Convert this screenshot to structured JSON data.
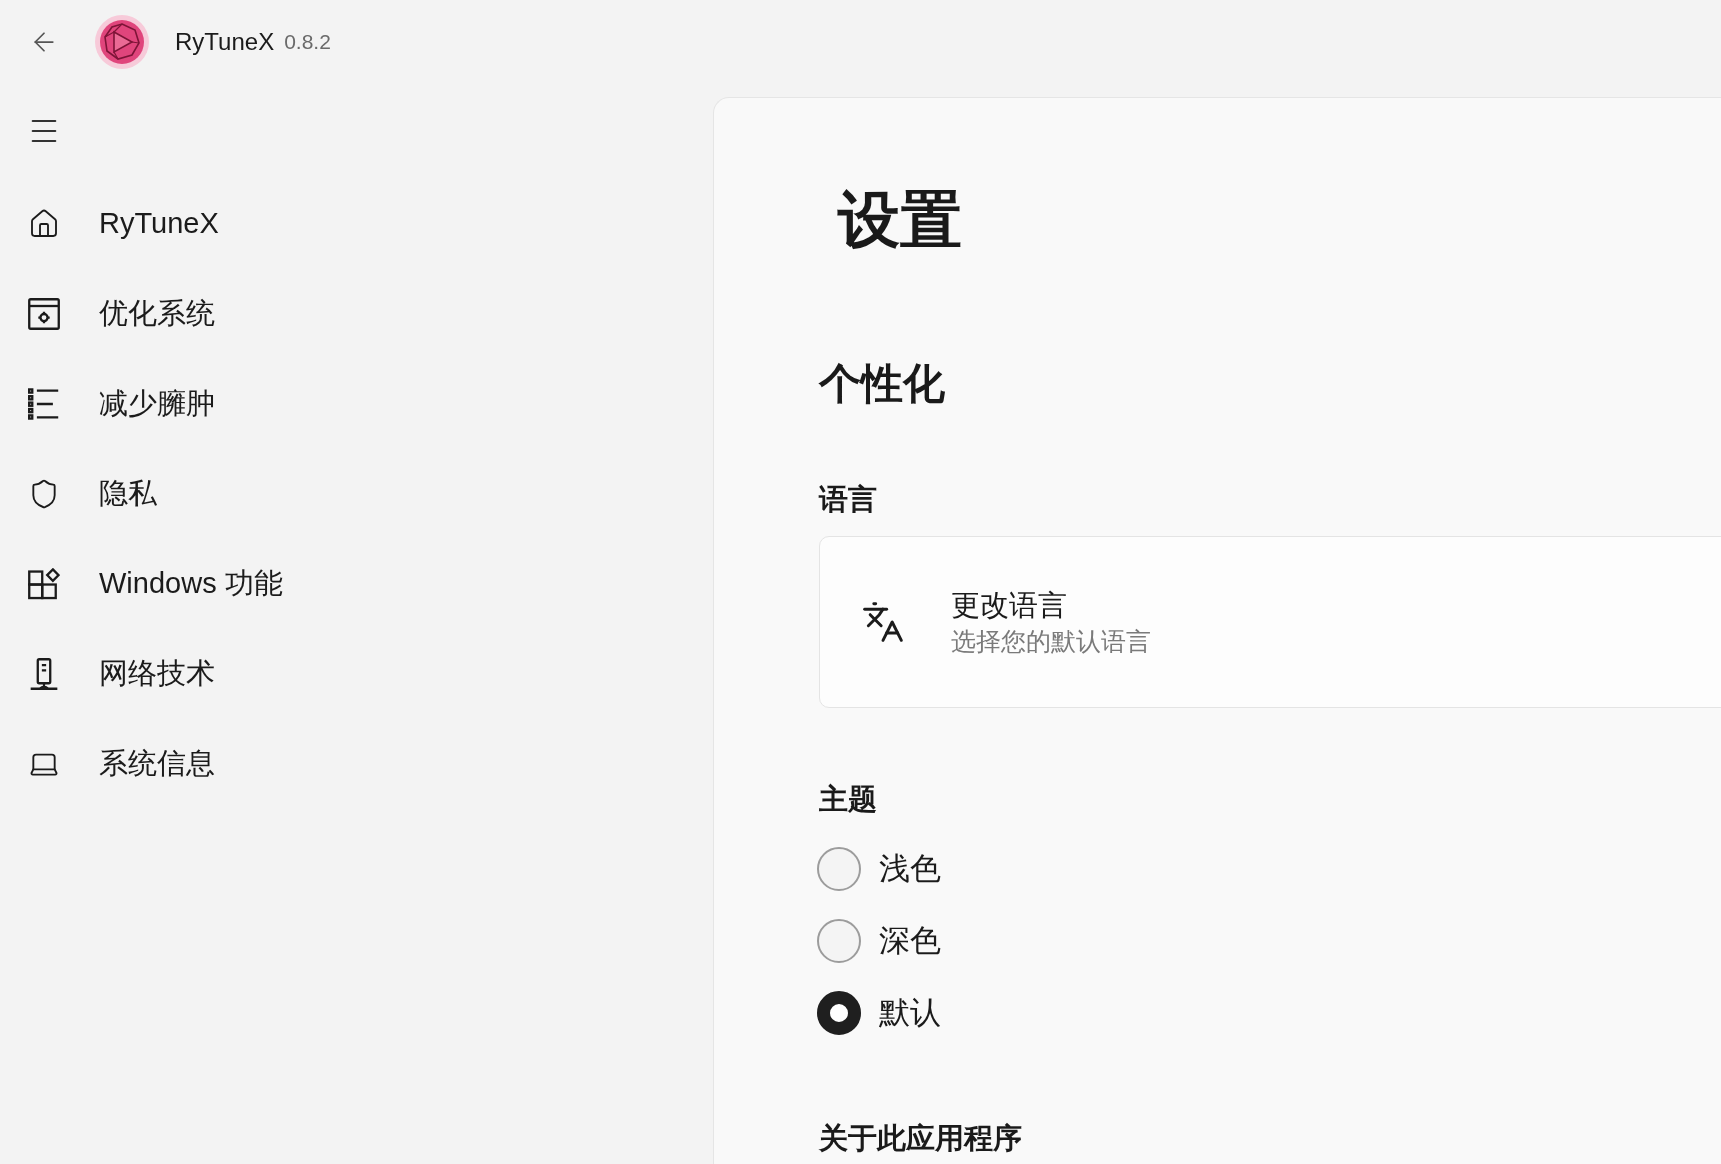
{
  "header": {
    "app_name": "RyTuneX",
    "version": "0.8.2"
  },
  "nav": {
    "items": [
      {
        "label": "RyTuneX",
        "selected": false
      },
      {
        "label": "优化系统",
        "selected": false
      },
      {
        "label": "减少臃肿",
        "selected": false
      },
      {
        "label": "隐私",
        "selected": false
      },
      {
        "label": "Windows 功能",
        "selected": false
      },
      {
        "label": "网络技术",
        "selected": false
      },
      {
        "label": "系统信息",
        "selected": false
      }
    ]
  },
  "page": {
    "title": "设置",
    "section_title": "个性化",
    "language": {
      "heading": "语言",
      "card": {
        "title": "更改语言",
        "description": "选择您的默认语言"
      }
    },
    "theme": {
      "heading": "主题",
      "options": [
        {
          "label": "浅色",
          "selected": false
        },
        {
          "label": "深色",
          "selected": false
        },
        {
          "label": "默认",
          "selected": true
        }
      ]
    },
    "about": {
      "heading": "关于此应用程序"
    }
  }
}
